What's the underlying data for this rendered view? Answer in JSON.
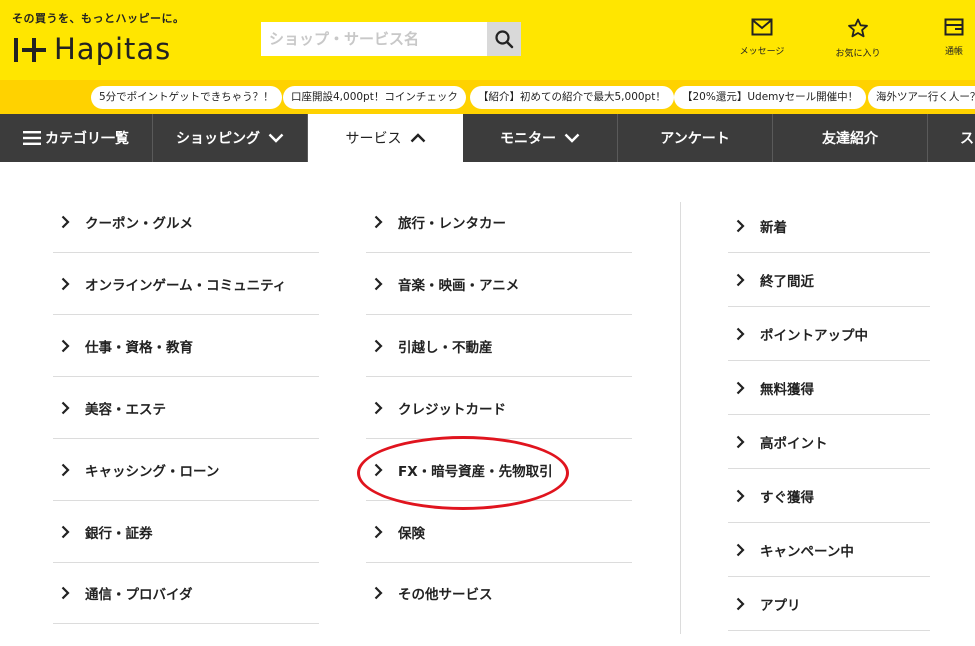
{
  "header": {
    "tagline": "その買うを、もっとハッピーに。",
    "logo_text": "Hapitas",
    "search": {
      "placeholder": "ショップ・サービス名",
      "value": ""
    },
    "icons": [
      {
        "icon": "mail-icon",
        "label": "メッセージ"
      },
      {
        "icon": "star-icon",
        "label": "お気に入り"
      },
      {
        "icon": "passbook-icon",
        "label": "通帳"
      }
    ]
  },
  "promo_pills": [
    "5分でポイントゲットできちゃう？！",
    "口座開設4,000pt！コインチェック",
    "【紹介】初めての紹介で最大5,000pt！",
    "【20%還元】Udemyセール開催中！",
    "海外ツアー行く人ー？"
  ],
  "nav": {
    "items": [
      {
        "label": "カテゴリ一覧",
        "icon": "hamburger-icon"
      },
      {
        "label": "ショッピング",
        "icon": "chevron-down-icon"
      },
      {
        "label": "サービス",
        "icon": "chevron-up-icon",
        "active": true
      },
      {
        "label": "モニター",
        "icon": "chevron-down-icon"
      },
      {
        "label": "アンケート"
      },
      {
        "label": "友達紹介"
      },
      {
        "label": "ス"
      }
    ]
  },
  "menu": {
    "column1": [
      "クーポン・グルメ",
      "オンラインゲーム・コミュニティ",
      "仕事・資格・教育",
      "美容・エステ",
      "キャッシング・ローン",
      "銀行・証券",
      "通信・プロバイダ"
    ],
    "column2": [
      "旅行・レンタカー",
      "音楽・映画・アニメ",
      "引越し・不動産",
      "クレジットカード",
      "FX・暗号資産・先物取引",
      "保険",
      "その他サービス"
    ],
    "column3": [
      "新着",
      "終了間近",
      "ポイントアップ中",
      "無料獲得",
      "高ポイント",
      "すぐ獲得",
      "キャンペーン中",
      "アプリ"
    ]
  },
  "colors": {
    "header_bg": "#ffe600",
    "pill_bar_bg": "#ffd200",
    "nav_bg": "#3c3c3c",
    "highlight": "#e0141e"
  }
}
